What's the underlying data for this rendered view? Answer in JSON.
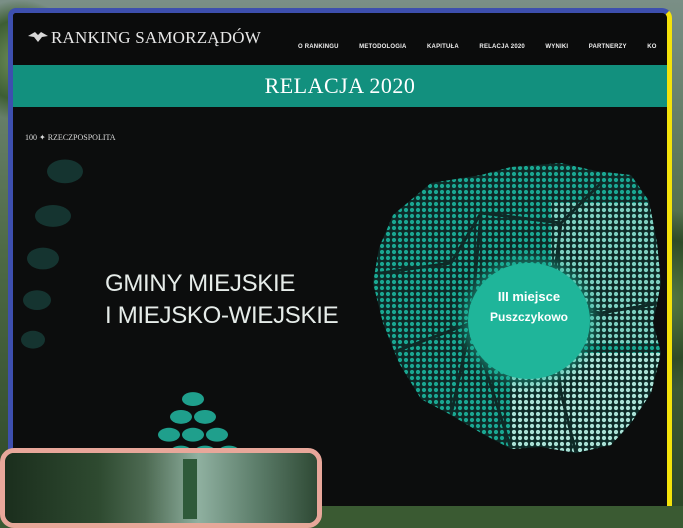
{
  "header": {
    "logo_text": "RANKING SAMORZĄDÓW",
    "nav_items": [
      "O RANKINGU",
      "METODOLOGIA",
      "KAPITUŁA",
      "RELACJA 2020",
      "WYNIKI",
      "PARTNERZY",
      "KO"
    ]
  },
  "banner": {
    "title": "RELACJA 2020"
  },
  "brand": {
    "small_logo": "100 ✦ RZECZPOSPOLITA"
  },
  "hero": {
    "line1": "GMINY MIEJSKIE",
    "line2": "I MIEJSKO-WIEJSKIE"
  },
  "badge": {
    "rank": "III miejsce",
    "city": "Puszczykowo"
  },
  "colors": {
    "accent": "#12907e",
    "badge": "#1fb59a",
    "frame_blue": "#3d4fae",
    "frame_yellow": "#f4e20a",
    "card_border": "#e8a79a"
  }
}
